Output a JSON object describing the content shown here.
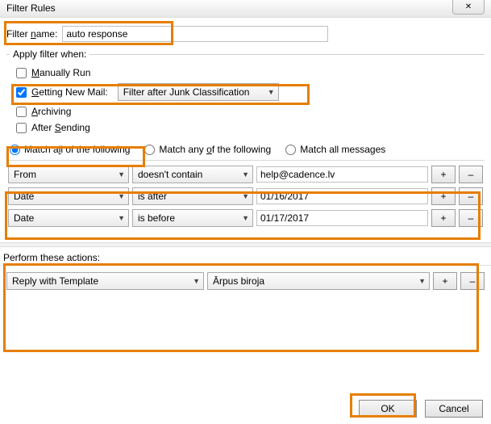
{
  "window": {
    "title": "Filter Rules",
    "close_glyph": "✕"
  },
  "filter_name": {
    "label_pre": "Filter ",
    "label_accel": "n",
    "label_post": "ame:",
    "value": "auto response"
  },
  "apply": {
    "legend": "Apply filter when:",
    "manually": {
      "accel": "M",
      "rest": "anually Run",
      "checked": false
    },
    "getting": {
      "accel": "G",
      "rest": "etting New Mail:",
      "checked": true,
      "select": "Filter after Junk Classification"
    },
    "archiving": {
      "accel": "A",
      "rest": "rchiving",
      "checked": false
    },
    "after": {
      "pre": "After ",
      "accel": "S",
      "rest": "ending",
      "checked": false
    }
  },
  "match": {
    "all": {
      "pre": "Match a",
      "accel": "l",
      "post": "l of the following",
      "selected": true
    },
    "any": {
      "pre": "Match any ",
      "accel": "o",
      "post": "f the following",
      "selected": false
    },
    "every": {
      "text": "Match all messages",
      "selected": false
    }
  },
  "conditions": [
    {
      "field": "From",
      "op": "doesn't contain",
      "value": "help@cadence.lv"
    },
    {
      "field": "Date",
      "op": "is after",
      "value": "01/16/2017"
    },
    {
      "field": "Date",
      "op": "is before",
      "value": "01/17/2017"
    }
  ],
  "actions_header": "Perform these actions:",
  "actions": [
    {
      "type": "Reply with Template",
      "template": "Ārpus biroja"
    }
  ],
  "buttons": {
    "ok": "OK",
    "cancel": "Cancel",
    "plus": "+",
    "minus": "–"
  }
}
